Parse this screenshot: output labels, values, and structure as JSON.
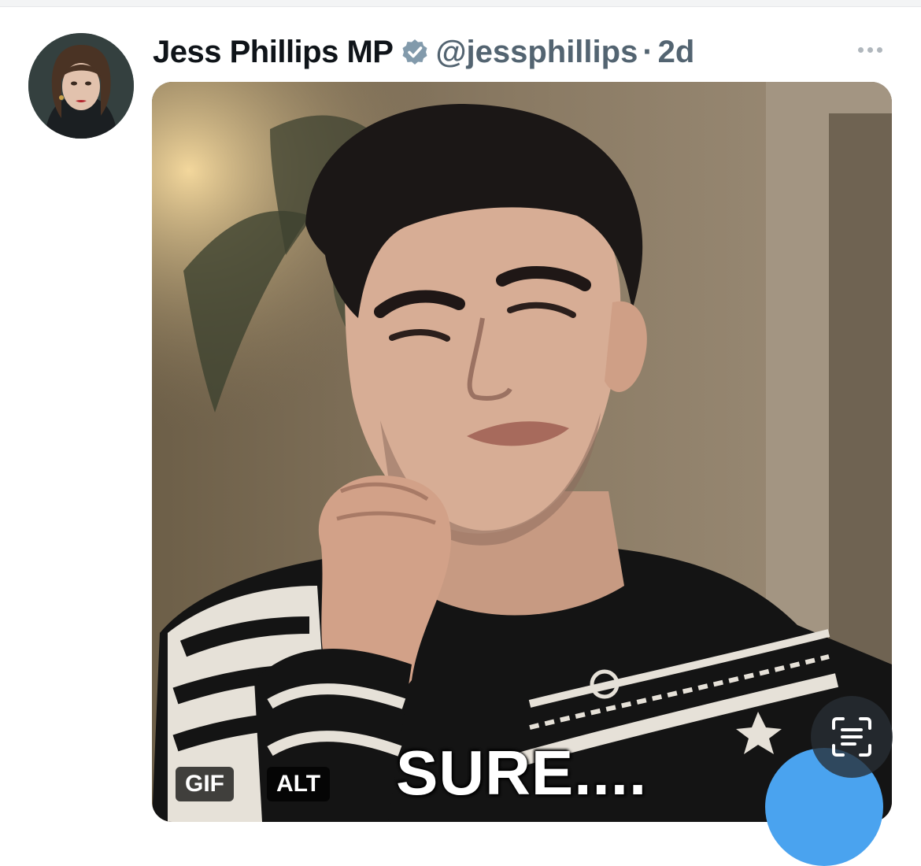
{
  "tweet": {
    "display_name": "Jess Phillips MP",
    "handle": "@jessphillips",
    "separator": "·",
    "time": "2d",
    "avatar_icon": "avatar-photo",
    "verified_icon": "verified-badge-icon",
    "more_icon": "more-options-icon"
  },
  "media": {
    "caption": "SURE....",
    "gif_label": "GIF",
    "alt_label": "ALT",
    "scan_icon": "text-scan-icon"
  },
  "colors": {
    "name": "#0f1419",
    "secondary": "#536471",
    "verified": "#829aab",
    "fab": "#4aa3ef"
  }
}
